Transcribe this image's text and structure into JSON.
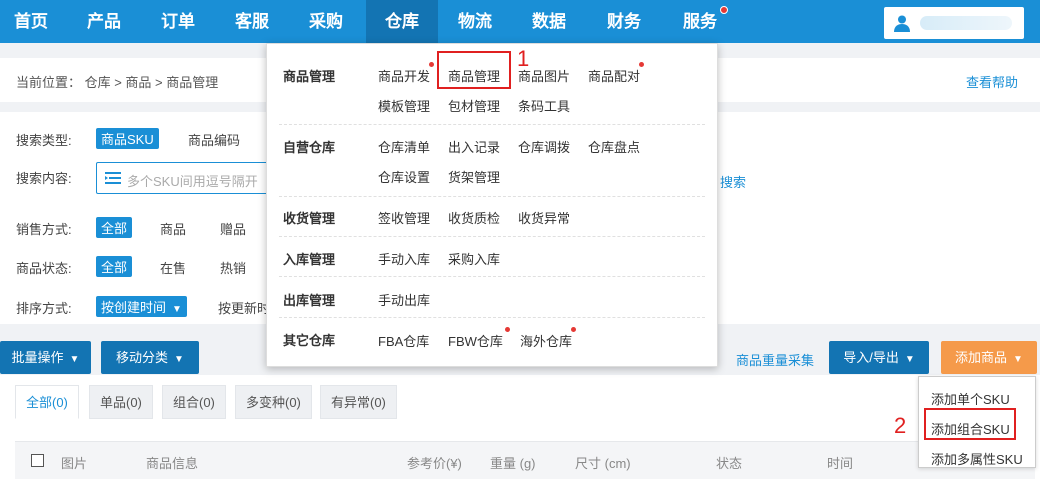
{
  "nav": {
    "items": [
      "首页",
      "产品",
      "订单",
      "客服",
      "采购",
      "仓库",
      "物流",
      "数据",
      "财务",
      "服务"
    ],
    "active": "仓库"
  },
  "breadcrumb": {
    "text": "当前位置：  仓库 > 商品 > 商品管理"
  },
  "help": {
    "label": "查看帮助"
  },
  "filters": {
    "search_type_label": "搜索类型:",
    "search_type_options": [
      "商品SKU",
      "商品编码"
    ],
    "search_content_label": "搜索内容:",
    "search_placeholder": "多个SKU间用逗号隔开",
    "search_link": "搜索",
    "sale_mode_label": "销售方式:",
    "sale_mode_options": [
      "全部",
      "商品",
      "赠品"
    ],
    "status_label": "商品状态:",
    "status_options": [
      "全部",
      "在售",
      "热销"
    ],
    "sort_label": "排序方式:",
    "sort_options": [
      "按创建时间",
      "按更新时"
    ]
  },
  "toolbar": {
    "batch": "批量操作",
    "move": "移动分类",
    "collect": "商品重量采集",
    "import_export": "导入/导出",
    "add_product": "添加商品"
  },
  "tabs": [
    "全部(0)",
    "单品(0)",
    "组合(0)",
    "多变种(0)",
    "有异常(0)"
  ],
  "table_headers": [
    "图片",
    "商品信息",
    "参考价(¥)",
    "重量 (g)",
    "尺寸 (cm)",
    "状态",
    "时间"
  ],
  "mega_menu": {
    "groups": [
      {
        "category": "商品管理",
        "items": [
          "商品开发",
          "商品管理",
          "商品图片",
          "商品配对",
          "模板管理",
          "包材管理",
          "条码工具"
        ]
      },
      {
        "category": "自营仓库",
        "items": [
          "仓库清单",
          "出入记录",
          "仓库调拨",
          "仓库盘点",
          "仓库设置",
          "货架管理"
        ]
      },
      {
        "category": "收货管理",
        "items": [
          "签收管理",
          "收货质检",
          "收货异常"
        ]
      },
      {
        "category": "入库管理",
        "items": [
          "手动入库",
          "采购入库"
        ]
      },
      {
        "category": "出库管理",
        "items": [
          "手动出库"
        ]
      },
      {
        "category": "其它仓库",
        "items": [
          "FBA仓库",
          "FBW仓库",
          "海外仓库"
        ]
      }
    ]
  },
  "add_menu": {
    "items": [
      "添加单个SKU",
      "添加组合SKU",
      "添加多属性SKU"
    ]
  },
  "annotations": {
    "step1": "1",
    "step2": "2"
  },
  "colors": {
    "primary": "#1a8fd6",
    "nav_active": "#1374b3",
    "accent": "#f59a4a",
    "highlight": "#e02020"
  }
}
